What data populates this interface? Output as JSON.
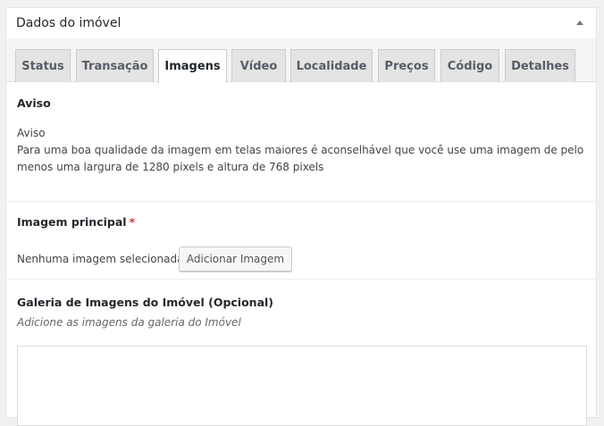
{
  "postbox": {
    "title": "Dados do imóvel",
    "toggle_icon": "triangle-up-icon"
  },
  "tabs": [
    {
      "label": "Status"
    },
    {
      "label": "Transação"
    },
    {
      "label": "Imagens",
      "active": true
    },
    {
      "label": "Vídeo"
    },
    {
      "label": "Localidade"
    },
    {
      "label": "Preços"
    },
    {
      "label": "Código"
    },
    {
      "label": "Detalhes"
    }
  ],
  "notice": {
    "heading": "Aviso",
    "subheading": "Aviso",
    "line1": "Para uma boa qualidade da imagem em telas maiores é aconselhável que você use uma imagem de pelo",
    "line2": "menos uma largura de 1280 pixels e altura de 768 pixels"
  },
  "main_image": {
    "label": "Imagem principal",
    "required_mark": "*",
    "status": "Nenhuma imagem selecionada",
    "button_label": "Adicionar Imagem"
  },
  "gallery": {
    "label": "Galeria de Imagens do Imóvel (Opcional)",
    "description": "Adicione as imagens da galeria do Imóvel"
  },
  "colors": {
    "required": "#dc3232",
    "panel_bg": "#ffffff",
    "page_bg": "#f1f1f1"
  }
}
